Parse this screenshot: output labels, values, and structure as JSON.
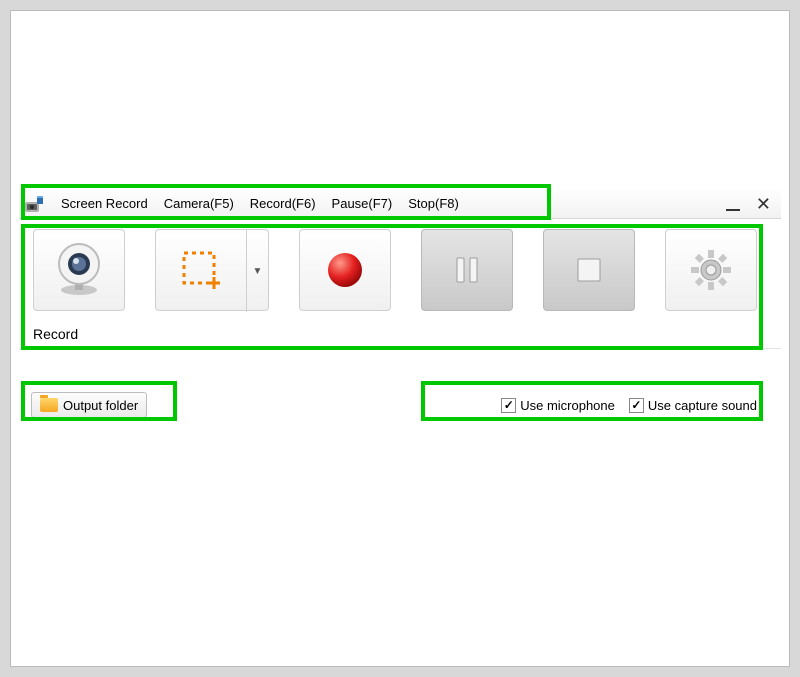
{
  "menu": {
    "title": "Screen Record",
    "items": [
      "Camera(F5)",
      "Record(F6)",
      "Pause(F7)",
      "Stop(F8)"
    ]
  },
  "toolbar": {
    "label": "Record",
    "buttons": {
      "camera": "Camera",
      "region": "Region",
      "record": "Record",
      "pause": "Pause",
      "stop": "Stop",
      "settings": "Settings"
    }
  },
  "footer": {
    "output_folder": "Output folder",
    "use_microphone": "Use microphone",
    "use_capture_sound": "Use capture sound",
    "mic_checked": true,
    "sound_checked": true
  }
}
